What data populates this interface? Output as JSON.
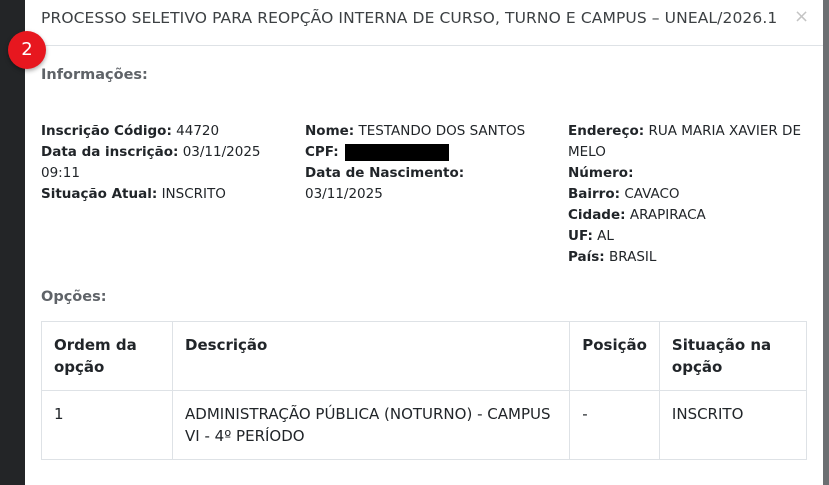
{
  "modal": {
    "title": "PROCESSO SELETIVO PARA REOPÇÃO INTERNA DE CURSO, TURNO E CAMPUS – UNEAL/2026.1",
    "close_label": "×",
    "step_badge": "2"
  },
  "info": {
    "section_title": "Informações:",
    "inscricao_codigo_label": "Inscrição Código:",
    "inscricao_codigo_value": "44720",
    "data_inscricao_label": "Data da inscrição:",
    "data_inscricao_value": "03/11/2025 09:11",
    "situacao_label": "Situação Atual:",
    "situacao_value": "INSCRITO",
    "nome_label": "Nome:",
    "nome_value": "TESTANDO DOS SANTOS",
    "cpf_label": "CPF:",
    "nascimento_label": "Data de Nascimento:",
    "nascimento_value": "03/11/2025",
    "endereco_label": "Endereço:",
    "endereco_value": "RUA MARIA XAVIER DE MELO",
    "numero_label": "Número:",
    "bairro_label": "Bairro:",
    "bairro_value": "CAVACO",
    "cidade_label": "Cidade:",
    "cidade_value": "ARAPIRACA",
    "uf_label": "UF:",
    "uf_value": "AL",
    "pais_label": "País:",
    "pais_value": "BRASIL"
  },
  "options": {
    "section_title": "Opções:",
    "headers": [
      "Ordem da opção",
      "Descrição",
      "Posição",
      "Situação na opção"
    ],
    "rows": [
      {
        "ordem": "1",
        "descricao": "ADMINISTRAÇÃO PÚBLICA (NOTURNO) - CAMPUS VI - 4º PERÍODO",
        "posicao": "-",
        "situacao": "INSCRITO"
      }
    ]
  },
  "colors": {
    "badge": "#e7171f",
    "section_title": "#5f6368"
  }
}
